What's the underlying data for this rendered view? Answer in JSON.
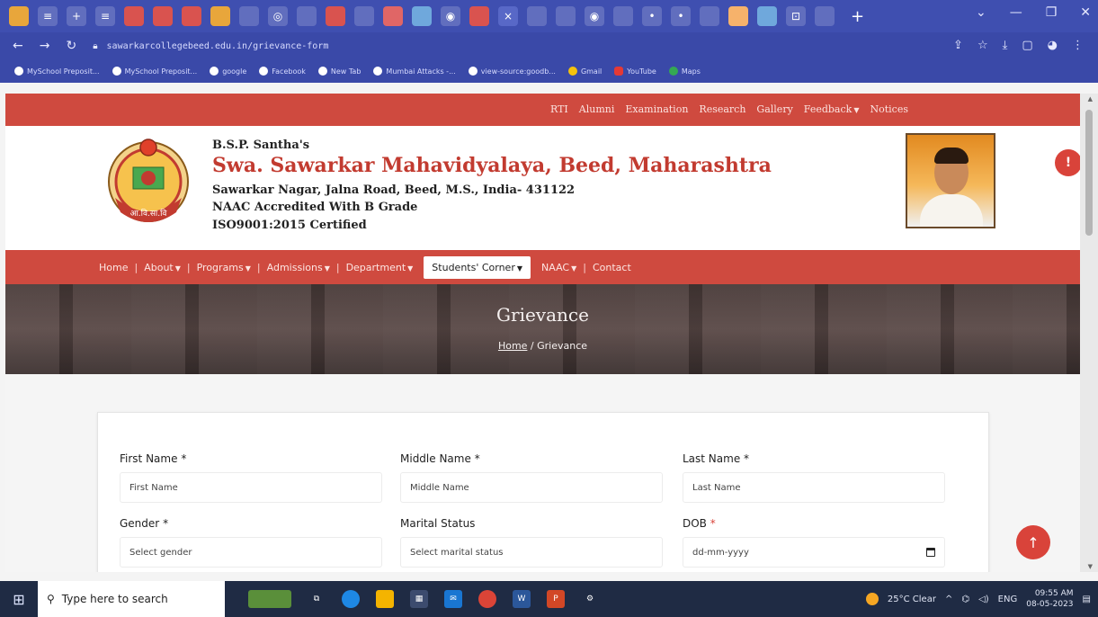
{
  "browser": {
    "url": "sawarkarcollegebeed.edu.in/grievance-form",
    "bookmarks": [
      "MySchool Preposit...",
      "MySchool Preposit...",
      "google",
      "Facebook",
      "New Tab",
      "Mumbai Attacks -...",
      "view-source:goodb...",
      "Gmail",
      "YouTube",
      "Maps"
    ]
  },
  "site": {
    "topnav": [
      "RTI",
      "Alumni",
      "Examination",
      "Research",
      "Gallery",
      "Feedback",
      "Notices"
    ],
    "header": {
      "pre_title": "B.S.P. Santha's",
      "title": "Swa. Sawarkar Mahavidyalaya, Beed, Maharashtra",
      "address": "Sawarkar Nagar, Jalna Road, Beed, M.S., India- 431122",
      "accreditation": "NAAC Accredited With B Grade",
      "iso": "ISO9001:2015 Certified",
      "logo_text": "आ.वि.सा.वि"
    },
    "mainnav": {
      "home": "Home",
      "about": "About",
      "programs": "Programs",
      "admissions": "Admissions",
      "department": "Department",
      "students_corner": "Students' Corner",
      "naac": "NAAC",
      "contact": "Contact"
    },
    "hero": {
      "title": "Grievance",
      "crumb_home": "Home",
      "crumb_sep": "/",
      "crumb_current": "Grievance"
    },
    "form": {
      "first_name": {
        "label": "First Name",
        "placeholder": "First Name"
      },
      "middle_name": {
        "label": "Middle Name",
        "placeholder": "Middle Name"
      },
      "last_name": {
        "label": "Last Name",
        "placeholder": "Last Name"
      },
      "gender": {
        "label": "Gender",
        "value": "Select gender"
      },
      "marital_status": {
        "label": "Marital Status",
        "value": "Select marital status"
      },
      "dob": {
        "label": "DOB",
        "placeholder": "dd-mm-yyyy"
      },
      "required_mark": "*"
    }
  },
  "taskbar": {
    "search_placeholder": "Type here to search",
    "weather": "25°C Clear",
    "lang": "ENG",
    "time": "09:55 AM",
    "date": "08-05-2023"
  },
  "colors": {
    "brand_red": "#cf4a3f",
    "title_red": "#c23b30",
    "browser_blue": "#3f4fb0"
  }
}
